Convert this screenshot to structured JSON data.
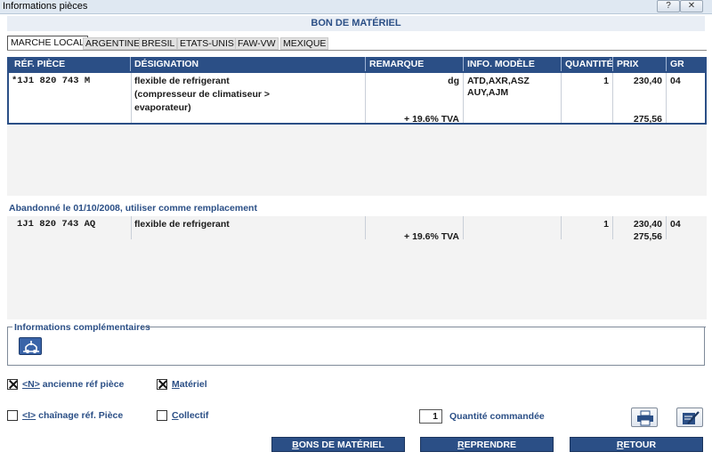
{
  "window": {
    "title": "Informations pièces",
    "help_glyph": "?",
    "close_glyph": "✕"
  },
  "header": {
    "title": "BON DE MATÉRIEL"
  },
  "tabs": [
    {
      "label": "MARCHE LOCAL",
      "active": true
    },
    {
      "label": "ARGENTINE"
    },
    {
      "label": "BRESIL"
    },
    {
      "label": "ETATS-UNIS"
    },
    {
      "label": "FAW-VW"
    },
    {
      "label": "MEXIQUE"
    }
  ],
  "table": {
    "columns": [
      "RÉF. PIÈCE",
      "DÉSIGNATION",
      "REMARQUE",
      "INFO. MODÈLE",
      "QUANTITÉ",
      "PRIX",
      "GR"
    ],
    "rows": [
      {
        "ref": "*1J1 820 743 M",
        "designation": [
          "flexible de refrigerant",
          "(compresseur de climatiseur >",
          " evaporateur)"
        ],
        "remarque": "dg",
        "tva": "+ 19.6% TVA",
        "info_modele": [
          "ATD,AXR,ASZ",
          "AUY,AJM"
        ],
        "quantite": "1",
        "prix": "230,40",
        "prix_ttc": "275,56",
        "gr": "04"
      }
    ]
  },
  "replacement": {
    "notice": "Abandonné le 01/10/2008, utiliser comme remplacement",
    "rows": [
      {
        "ref": "1J1 820 743 AQ",
        "designation": "flexible de refrigerant",
        "tva": "+ 19.6% TVA",
        "quantite": "1",
        "prix": "230,40",
        "prix_ttc": "275,56",
        "gr": "04"
      }
    ]
  },
  "info_complementaires": {
    "legend": "Informations complémentaires",
    "icon": "model-info-icon"
  },
  "options": {
    "ancienne_ref": {
      "key": "<N>",
      "label": " ancienne réf pièce",
      "checked": true
    },
    "materiel": {
      "key": "M",
      "label": "atériel",
      "checked": true
    },
    "chainage": {
      "key": "<I>",
      "label": " chaînage réf. Pièce",
      "checked": false
    },
    "collectif": {
      "key": "C",
      "label": "ollectif",
      "checked": false
    }
  },
  "quantity": {
    "value": "1",
    "label": "Quantité commandée"
  },
  "toolbar_icons": [
    "printer-icon",
    "edit-document-icon"
  ],
  "buttons": {
    "bons": {
      "key": "B",
      "rest": "ONS DE MATÉRIEL"
    },
    "reprendre": {
      "key": "R",
      "rest": "EPRENDRE"
    },
    "retour": {
      "key": "R",
      "rest": "ETOUR"
    }
  }
}
